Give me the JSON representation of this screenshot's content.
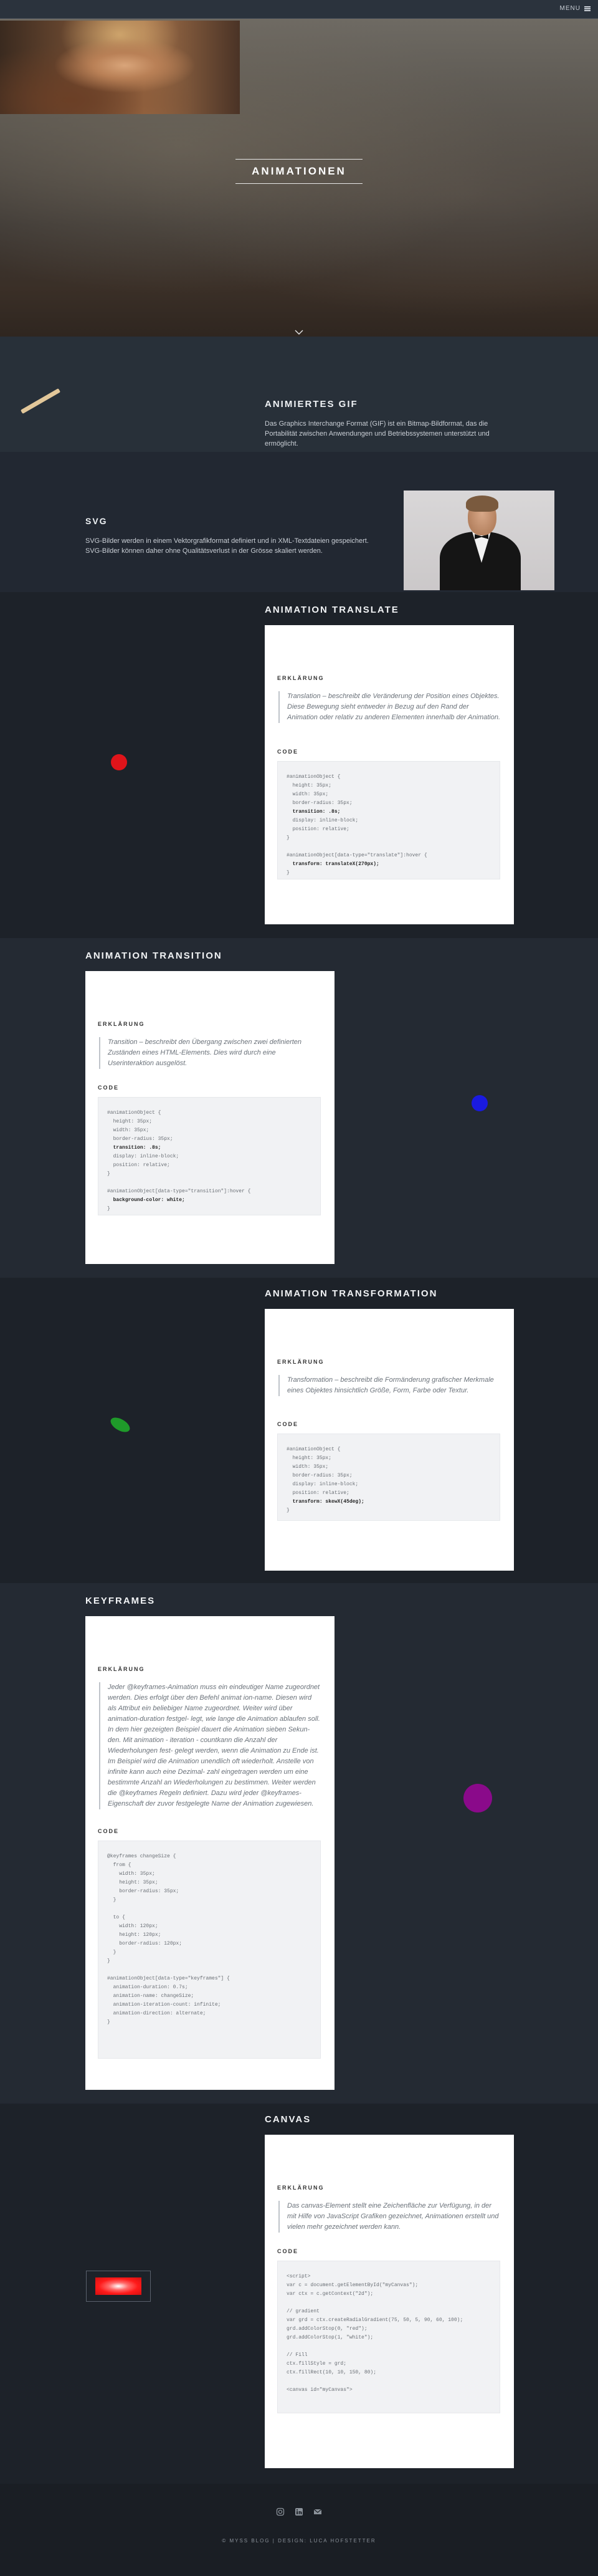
{
  "nav": {
    "menu_label": "MENU",
    "menu_icon": "hamburger-icon"
  },
  "hero": {
    "title": "ANIMATIONEN",
    "scroll_icon": "chevron-down-icon"
  },
  "gif": {
    "title": "ANIMIERTES GIF",
    "text": "Das Graphics Interchange Format (GIF) ist ein Bitmap-Bildformat, das die Portabilität zwischen Anwendungen und Betriebssystemen unterstützt und ermöglicht."
  },
  "svg": {
    "title": "SVG",
    "text": "SVG-Bilder werden in einem Vektorgrafikformat definiert und in XML-Textdateien gespeichert. SVG-Bilder können daher ohne Qualitätsverlust in der Grösse skaliert werden."
  },
  "translate": {
    "title": "ANIMATION TRANSLATE",
    "label_expl": "ERKLÄRUNG",
    "text": "Translation – beschreibt die Veränderung der Position eines Objektes. Diese Bewegung sieht entweder in Bezug auf den Rand der Animation oder relativ zu anderen Elementen innerhalb der Animation.",
    "label_code": "CODE",
    "dot_color": "#e0141a"
  },
  "transition": {
    "title": "ANIMATION TRANSITION",
    "label_expl": "ERKLÄRUNG",
    "text": "Transition – beschreibt den Übergang zwischen zwei definierten Zuständen eines HTML-Elements. Dies wird durch eine Userinteraktion ausgelöst.",
    "label_code": "CODE",
    "dot_color": "#1a1ae0"
  },
  "transform": {
    "title": "ANIMATION TRANSFORMATION",
    "label_expl": "ERKLÄRUNG",
    "text": "Transformation – beschreibt die Formänderung grafischer Merkmale eines Objektes hinsichtlich Größe, Form, Farbe oder Textur.",
    "label_code": "CODE",
    "dot_color": "#1f9a2a"
  },
  "keyframes": {
    "title": "KEYFRAMES",
    "label_expl": "ERKLÄRUNG",
    "text": "Jeder @keyframes-Animation muss ein eindeutiger Name zugeordnet werden. Dies erfolgt über den Befehl animat ion-name. Diesen wird als Attribut ein beliebiger Name zugeordnet. Weiter wird über animation-duration festgel- legt, wie lange die Animation ablaufen soll. In dem hier gezeigten Beispiel dauert die Animation sieben Sekun- den. Mit animation - iteration - countkann die Anzahl der Wiederholungen fest- gelegt werden, wenn die Animation zu Ende ist. Im Beispiel wird die Animation unendlich oft wiederholt. Anstelle von infinite kann auch eine Dezimal- zahl eingetragen werden um eine bestimmte Anzahl an Wiederholungen zu bestimmen. Weiter werden die @keyframes Regeln definiert. Dazu wird jeder @keyframes-Eigenschaft der zuvor festgelegte Name der Animation zugewiesen.",
    "label_code": "CODE",
    "dot_color": "#8a0a8a"
  },
  "canvas": {
    "title": "CANVAS",
    "label_expl": "ERKLÄRUNG",
    "text": "Das canvas-Element stellt eine Zeichenfläche zur Verfügung, in der mit Hilfe von JavaScript Grafiken gezeichnet, Animationen erstellt und vielen mehr gezeichnet werden kann.",
    "label_code": "CODE",
    "demo_color": "#ff2a2a"
  },
  "footer": {
    "icons": [
      "instagram-icon",
      "linkedin-icon",
      "mail-icon"
    ],
    "copyright": "© MYSS BLOG | DESIGN: LUCA HOFSTETTER"
  }
}
